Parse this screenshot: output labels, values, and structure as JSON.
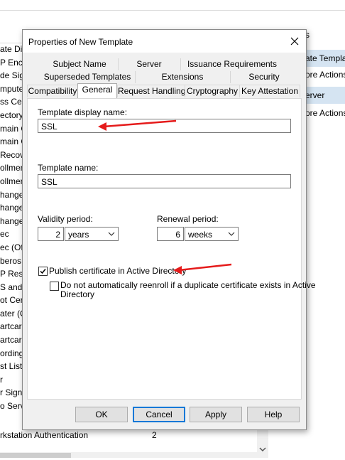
{
  "background": {
    "header_right": "s",
    "left_list": [
      "ate Dis",
      "P Encry",
      "de Sign",
      "mpute",
      "ss Cer",
      "ectory",
      "main C",
      "main C",
      "Recov",
      "ollmen",
      "ollmen",
      "hange",
      "hange",
      "hange",
      "ec",
      "ec (Off",
      "beros",
      "P Res",
      "S and I",
      "ot Cert",
      "ater (O",
      "artcar",
      "artcar",
      "ording",
      "st List",
      "r",
      "r Sign",
      "o Serv"
    ],
    "right_actions": [
      {
        "label": "ate Templa",
        "type": "header"
      },
      {
        "label": "ore Actions",
        "type": "item"
      },
      {
        "label": "erver",
        "type": "header"
      },
      {
        "label": "ore Actions",
        "type": "item"
      }
    ],
    "bottom_row": {
      "name": "rkstation Authentication",
      "value": "2"
    }
  },
  "dialog": {
    "title": "Properties of New Template",
    "tabs_row1": [
      "Subject Name",
      "Server",
      "Issuance Requirements"
    ],
    "tabs_row2": [
      "Superseded Templates",
      "Extensions",
      "Security"
    ],
    "tabs_row3": [
      "Compatibility",
      "General",
      "Request Handling",
      "Cryptography",
      "Key Attestation"
    ],
    "active_tab": "General",
    "template_display_name_label": "Template display name:",
    "template_display_name_value": "SSL",
    "template_name_label": "Template name:",
    "template_name_value": "SSL",
    "validity_label": "Validity period:",
    "validity_number": "2",
    "validity_unit": "years",
    "renewal_label": "Renewal period:",
    "renewal_number": "6",
    "renewal_unit": "weeks",
    "publish_label": "Publish certificate in Active Directory",
    "publish_checked": true,
    "no_reenroll_label_line1": "Do not automatically reenroll if a duplicate certificate exists in Active",
    "no_reenroll_label_line2": "Directory",
    "no_reenroll_checked": false,
    "buttons": {
      "ok": "OK",
      "cancel": "Cancel",
      "apply": "Apply",
      "help": "Help"
    }
  },
  "colors": {
    "annotation_arrow": "#e51b1b",
    "focus_border": "#0078d7",
    "action_header": "#d5e4f2"
  }
}
